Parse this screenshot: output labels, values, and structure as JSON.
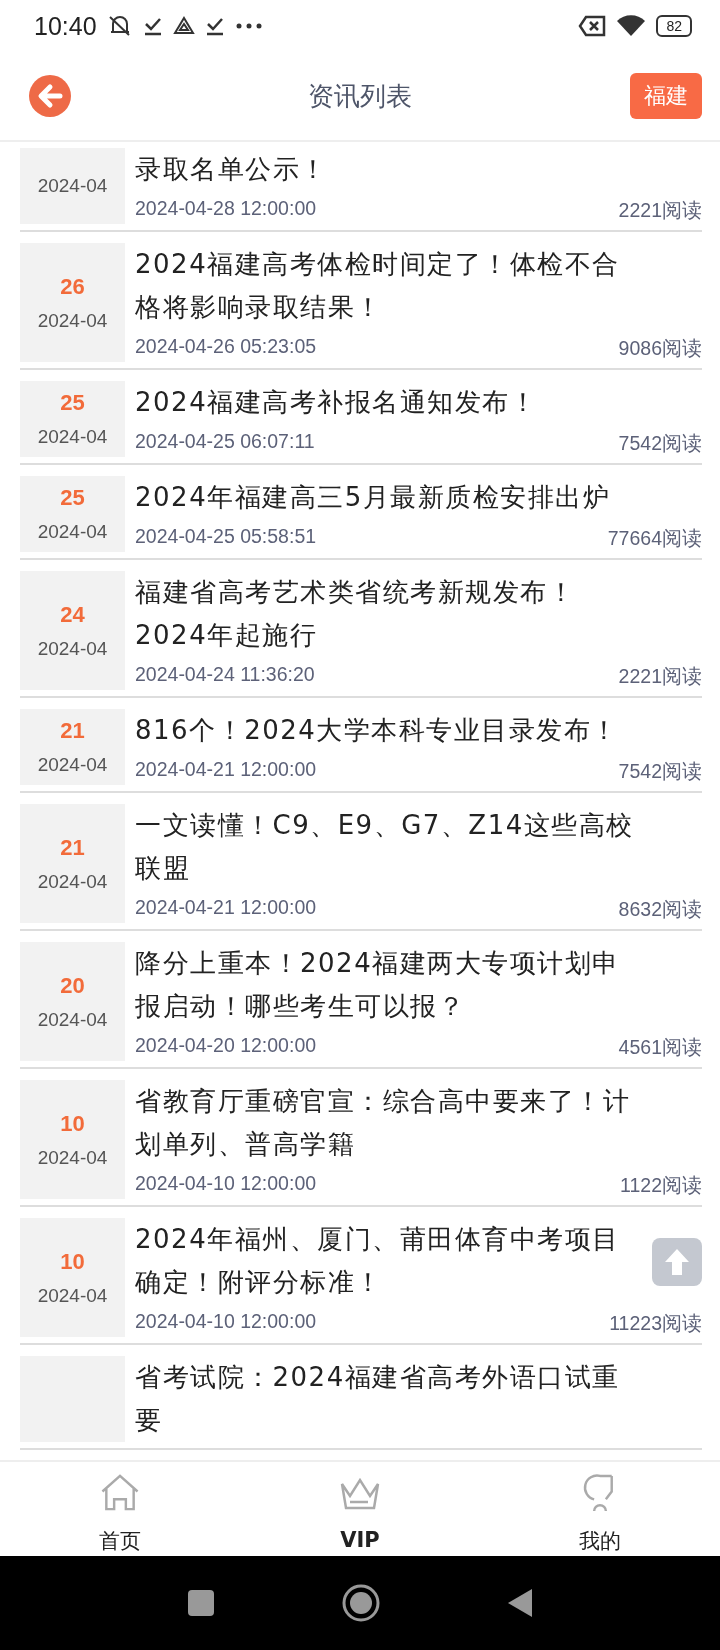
{
  "status_bar": {
    "time": "10:40",
    "battery": "82"
  },
  "header": {
    "title": "资讯列表",
    "region_button": "福建"
  },
  "articles": [
    {
      "month": "2024-04",
      "title": "录取名单公示！",
      "time": "2024-04-28 12:00:00",
      "reads": "2221阅读"
    },
    {
      "day": "26",
      "month": "2024-04",
      "title": "2024福建高考体检时间定了！体检不合格将影响录取结果！",
      "time": "2024-04-26 05:23:05",
      "reads": "9086阅读"
    },
    {
      "day": "25",
      "month": "2024-04",
      "title": "2024福建高考补报名通知发布！",
      "time": "2024-04-25 06:07:11",
      "reads": "7542阅读"
    },
    {
      "day": "25",
      "month": "2024-04",
      "title": "2024年福建高三5月最新质检安排出炉",
      "time": "2024-04-25 05:58:51",
      "reads": "77664阅读"
    },
    {
      "day": "24",
      "month": "2024-04",
      "title": "福建省高考艺术类省统考新规发布！2024年起施行",
      "time": "2024-04-24 11:36:20",
      "reads": "2221阅读"
    },
    {
      "day": "21",
      "month": "2024-04",
      "title": "816个！2024大学本科专业目录发布！",
      "time": "2024-04-21 12:00:00",
      "reads": "7542阅读"
    },
    {
      "day": "21",
      "month": "2024-04",
      "title": "一文读懂！C9、E9、G7、Z14这些高校联盟",
      "time": "2024-04-21 12:00:00",
      "reads": "8632阅读"
    },
    {
      "day": "20",
      "month": "2024-04",
      "title": "降分上重本！2024福建两大专项计划申报启动！哪些考生可以报？",
      "time": "2024-04-20 12:00:00",
      "reads": "4561阅读"
    },
    {
      "day": "10",
      "month": "2024-04",
      "title": "省教育厅重磅官宣：综合高中要来了！计划单列、普高学籍",
      "time": "2024-04-10 12:00:00",
      "reads": "1122阅读"
    },
    {
      "day": "10",
      "month": "2024-04",
      "title": "2024年福州、厦门、莆田体育中考项目确定！附评分标准！",
      "time": "2024-04-10 12:00:00",
      "reads": "11223阅读"
    },
    {
      "title": "省考试院：2024福建省高考外语口试重要"
    }
  ],
  "tab_bar": [
    {
      "kind": "home",
      "label": "首页",
      "selected": false
    },
    {
      "kind": "vip",
      "label": "VIP",
      "selected": true
    },
    {
      "kind": "profile",
      "label": "我的",
      "selected": false
    }
  ]
}
